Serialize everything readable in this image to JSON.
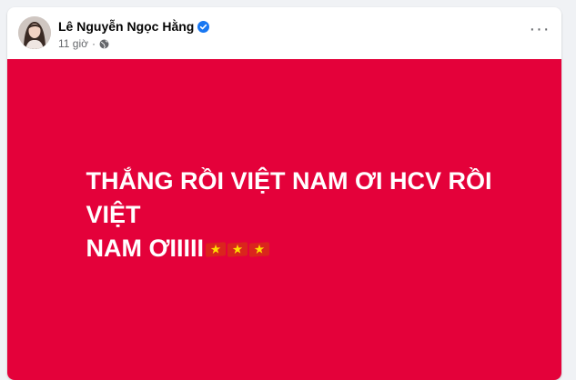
{
  "post": {
    "author": {
      "name": "Lê Nguyễn Ngọc Hằng",
      "verified": true,
      "avatar_icon": "profile-photo"
    },
    "timestamp": "11 giờ",
    "separator": "·",
    "privacy_icon": "globe-icon",
    "more_icon": "more-options-icon",
    "more_label": "···",
    "status": {
      "line1": "THẮNG RỒI VIỆT NAM ƠI HCV RỒI VIỆT",
      "line2": "NAM ƠIIIII",
      "emoji": [
        "flag-vietnam",
        "flag-vietnam",
        "flag-vietnam"
      ],
      "background_color": "#e4013a",
      "text_color": "#ffffff"
    }
  },
  "colors": {
    "page_bg": "#f0f2f5",
    "verified_blue": "#1877f2",
    "secondary_text": "#65676b"
  }
}
